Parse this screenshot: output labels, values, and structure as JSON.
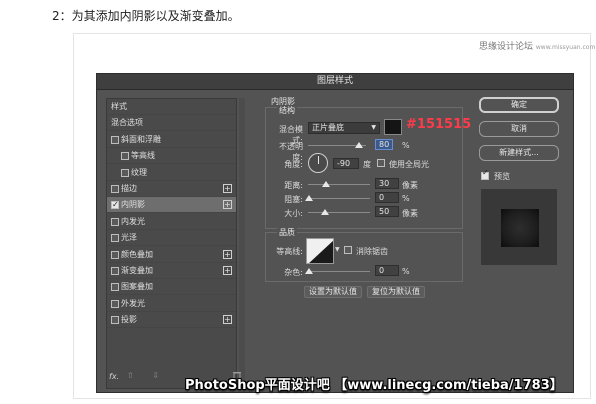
{
  "heading": "2：为其添加内阴影以及渐变叠加。",
  "site_watermark": "思缘设计论坛",
  "site_watermark_small": "www.missyuan.com",
  "dialog": {
    "title": "图层样式",
    "style_list": [
      {
        "label": "样式",
        "checkbox": false,
        "plus": false,
        "indent": 0
      },
      {
        "label": "混合选项",
        "checkbox": false,
        "plus": false,
        "indent": 0
      },
      {
        "label": "斜面和浮雕",
        "checkbox": true,
        "checked": false,
        "plus": false,
        "indent": 0
      },
      {
        "label": "等高线",
        "checkbox": true,
        "checked": false,
        "plus": false,
        "indent": 1
      },
      {
        "label": "纹理",
        "checkbox": true,
        "checked": false,
        "plus": false,
        "indent": 1
      },
      {
        "label": "描边",
        "checkbox": true,
        "checked": false,
        "plus": true,
        "indent": 0
      },
      {
        "label": "内阴影",
        "checkbox": true,
        "checked": true,
        "plus": true,
        "indent": 0,
        "selected": true
      },
      {
        "label": "内发光",
        "checkbox": true,
        "checked": false,
        "plus": false,
        "indent": 0
      },
      {
        "label": "光泽",
        "checkbox": true,
        "checked": false,
        "plus": false,
        "indent": 0
      },
      {
        "label": "颜色叠加",
        "checkbox": true,
        "checked": false,
        "plus": true,
        "indent": 0
      },
      {
        "label": "渐变叠加",
        "checkbox": true,
        "checked": false,
        "plus": true,
        "indent": 0
      },
      {
        "label": "图案叠加",
        "checkbox": true,
        "checked": false,
        "plus": false,
        "indent": 0
      },
      {
        "label": "外发光",
        "checkbox": true,
        "checked": false,
        "plus": false,
        "indent": 0
      },
      {
        "label": "投影",
        "checkbox": true,
        "checked": false,
        "plus": true,
        "indent": 0
      }
    ],
    "fx_label": "fx.",
    "fx_arrows": "⇧ ⇩",
    "trash_icon": "trash-icon",
    "inner_shadow": {
      "section_title": "内阴影",
      "structure_title": "结构",
      "blend_mode_label": "混合模式:",
      "blend_mode_value": "正片叠底",
      "color": "#151515",
      "color_note": "#151515",
      "opacity_label": "不透明度:",
      "opacity_value": "80",
      "opacity_unit": "%",
      "angle_label": "角度:",
      "angle_value": "-90",
      "angle_unit": "度",
      "global_light_label": "使用全局光",
      "distance_label": "距离:",
      "distance_value": "30",
      "distance_unit": "像素",
      "choke_label": "阻塞:",
      "choke_value": "0",
      "choke_unit": "%",
      "size_label": "大小:",
      "size_value": "50",
      "size_unit": "像素",
      "quality_title": "品质",
      "contour_label": "等高线:",
      "anti_alias_label": "消除锯齿",
      "noise_label": "杂色:",
      "noise_value": "0",
      "noise_unit": "%",
      "set_default_label": "设置为默认值",
      "reset_default_label": "复位为默认值"
    },
    "buttons": {
      "ok": "确定",
      "cancel": "取消",
      "new_style": "新建样式...",
      "preview": "预览"
    }
  },
  "watermark": "PhotoShop平面设计吧 【www.linecg.com/tieba/1783】"
}
